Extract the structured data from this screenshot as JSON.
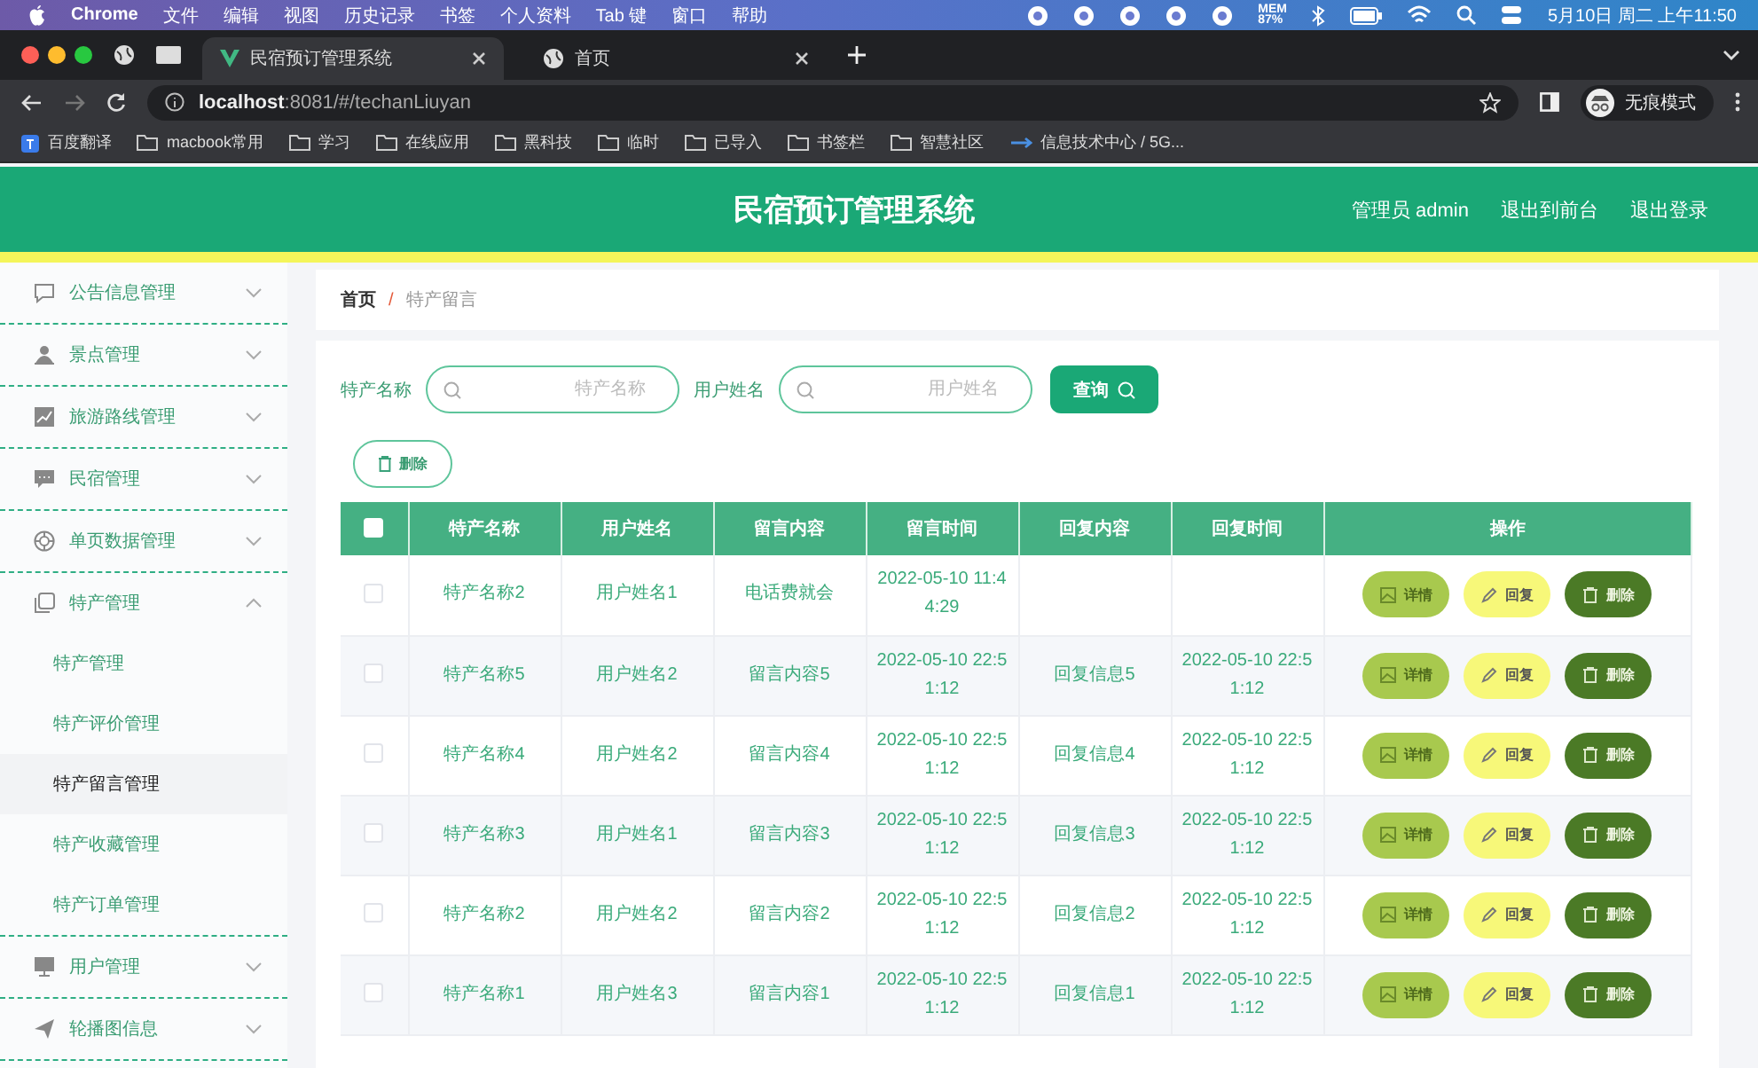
{
  "menu_bar": {
    "app": "Chrome",
    "items": [
      "文件",
      "编辑",
      "视图",
      "历史记录",
      "书签",
      "个人资料",
      "Tab 键",
      "窗口",
      "帮助"
    ],
    "memory": {
      "label": "MEM",
      "value": "87%"
    },
    "clock": "5月10日 周二 上午11:50"
  },
  "browser": {
    "tabs": [
      {
        "title": "民宿预订管理系统",
        "selected": true
      },
      {
        "title": "首页",
        "selected": false
      }
    ],
    "url": {
      "host": "localhost",
      "path": ":8081/#/techanLiuyan"
    },
    "profile": "无痕模式",
    "bookmarks": [
      {
        "label": "百度翻译",
        "kind": "app"
      },
      {
        "label": "macbook常用",
        "kind": "folder"
      },
      {
        "label": "学习",
        "kind": "folder"
      },
      {
        "label": "在线应用",
        "kind": "folder"
      },
      {
        "label": "黑科技",
        "kind": "folder"
      },
      {
        "label": "临时",
        "kind": "folder"
      },
      {
        "label": "已导入",
        "kind": "folder"
      },
      {
        "label": "书签栏",
        "kind": "folder"
      },
      {
        "label": "智慧社区",
        "kind": "folder"
      },
      {
        "label": "信息技术中心 / 5G...",
        "kind": "link"
      }
    ]
  },
  "header": {
    "title": "民宿预订管理系统",
    "user": "管理员 admin",
    "links": [
      "退出到前台",
      "退出登录"
    ]
  },
  "sidebar": {
    "items": [
      {
        "label": "公告信息管理",
        "expanded": false
      },
      {
        "label": "景点管理",
        "expanded": false
      },
      {
        "label": "旅游路线管理",
        "expanded": false
      },
      {
        "label": "民宿管理",
        "expanded": false
      },
      {
        "label": "单页数据管理",
        "expanded": false
      },
      {
        "label": "特产管理",
        "expanded": true,
        "children": [
          {
            "label": "特产管理",
            "selected": false
          },
          {
            "label": "特产评价管理",
            "selected": false
          },
          {
            "label": "特产留言管理",
            "selected": true
          },
          {
            "label": "特产收藏管理",
            "selected": false
          },
          {
            "label": "特产订单管理",
            "selected": false
          }
        ]
      },
      {
        "label": "用户管理",
        "expanded": false
      },
      {
        "label": "轮播图信息",
        "expanded": false
      }
    ]
  },
  "breadcrumb": {
    "items": [
      "首页",
      "特产留言"
    ],
    "separator": "/"
  },
  "search": {
    "fields": [
      {
        "label": "特产名称",
        "placeholder": "特产名称"
      },
      {
        "label": "用户姓名",
        "placeholder": "用户姓名"
      }
    ],
    "button": "查询"
  },
  "delete_button": "删除",
  "table": {
    "all_checked": false,
    "columns": [
      "特产名称",
      "用户姓名",
      "留言内容",
      "留言时间",
      "回复内容",
      "回复时间",
      "操作"
    ],
    "rows": [
      {
        "checked": false,
        "cells": [
          "特产名称2",
          "用户姓名1",
          "电话费就会",
          "2022-05-10 11:44:29",
          "",
          ""
        ],
        "actions": [
          {
            "kind": "detail",
            "label": "详情"
          },
          {
            "kind": "reply",
            "label": "回复"
          },
          {
            "kind": "delete",
            "label": "删除"
          }
        ]
      },
      {
        "checked": false,
        "cells": [
          "特产名称5",
          "用户姓名2",
          "留言内容5",
          "2022-05-10 22:51:12",
          "回复信息5",
          "2022-05-10 22:51:12"
        ],
        "actions": [
          {
            "kind": "detail",
            "label": "详情"
          },
          {
            "kind": "reply",
            "label": "回复"
          },
          {
            "kind": "delete",
            "label": "删除"
          }
        ]
      },
      {
        "checked": false,
        "cells": [
          "特产名称4",
          "用户姓名2",
          "留言内容4",
          "2022-05-10 22:51:12",
          "回复信息4",
          "2022-05-10 22:51:12"
        ],
        "actions": [
          {
            "kind": "detail",
            "label": "详情"
          },
          {
            "kind": "reply",
            "label": "回复"
          },
          {
            "kind": "delete",
            "label": "删除"
          }
        ]
      },
      {
        "checked": false,
        "cells": [
          "特产名称3",
          "用户姓名1",
          "留言内容3",
          "2022-05-10 22:51:12",
          "回复信息3",
          "2022-05-10 22:51:12"
        ],
        "actions": [
          {
            "kind": "detail",
            "label": "详情"
          },
          {
            "kind": "reply",
            "label": "回复"
          },
          {
            "kind": "delete",
            "label": "删除"
          }
        ]
      },
      {
        "checked": false,
        "cells": [
          "特产名称2",
          "用户姓名2",
          "留言内容2",
          "2022-05-10 22:51:12",
          "回复信息2",
          "2022-05-10 22:51:12"
        ],
        "actions": [
          {
            "kind": "detail",
            "label": "详情"
          },
          {
            "kind": "reply",
            "label": "回复"
          },
          {
            "kind": "delete",
            "label": "删除"
          }
        ]
      },
      {
        "checked": false,
        "cells": [
          "特产名称1",
          "用户姓名3",
          "留言内容1",
          "2022-05-10 22:51:12",
          "回复信息1",
          "2022-05-10 22:51:12"
        ],
        "actions": [
          {
            "kind": "detail",
            "label": "详情"
          },
          {
            "kind": "reply",
            "label": "回复"
          },
          {
            "kind": "delete",
            "label": "删除"
          }
        ]
      }
    ]
  }
}
